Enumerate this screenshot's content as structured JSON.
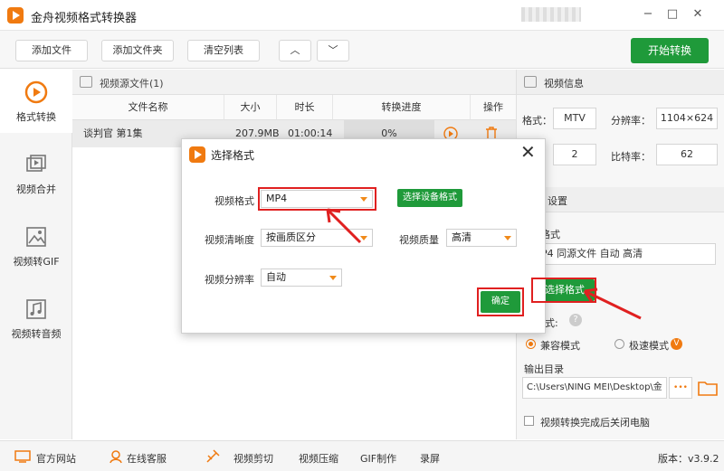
{
  "app": {
    "title": "金舟视频格式转换器",
    "minimize": "−",
    "maximize": "□",
    "close": "✕"
  },
  "toolbar": {
    "add_file": "添加文件",
    "add_folder": "添加文件夹",
    "clear_list": "清空列表",
    "up": "︿",
    "down": "﹀",
    "start": "开始转换"
  },
  "nav": [
    {
      "label": "格式转换",
      "icon": "format-convert-icon",
      "active": true
    },
    {
      "label": "视频合并",
      "icon": "video-merge-icon",
      "active": false
    },
    {
      "label": "视频转GIF",
      "icon": "video-to-gif-icon",
      "active": false
    },
    {
      "label": "视频转音频",
      "icon": "video-to-audio-icon",
      "active": false
    }
  ],
  "file_list": {
    "header": "视频源文件(1)",
    "columns": [
      "文件名称",
      "大小",
      "时长",
      "转换进度",
      "操作"
    ],
    "rows": [
      {
        "name": "谈判官 第1集",
        "size": "207.9MB",
        "duration": "01:00:14",
        "progress": "0%"
      }
    ]
  },
  "video_info": {
    "header": "视频信息",
    "format_label": "格式：",
    "format": "MTV",
    "resolution_label": "分辨率：",
    "resolution": "1104×624",
    "frame_value": "2",
    "ratio_label": "比特率：",
    "ratio": "62"
  },
  "output": {
    "header": "设置",
    "format_label": "格式",
    "format_summary": "P4 同源文件 自动 高清",
    "choose_format": "选择格式",
    "mode_label": "模式:",
    "mode_compat": "兼容模式",
    "mode_fast": "极速模式",
    "vip_badge": "V",
    "dir_label": "输出目录",
    "dir_value": "C:\\Users\\NING MEI\\Desktop\\金",
    "dots": "•••",
    "shutdown": "视频转换完成后关闭电脑"
  },
  "footer": {
    "website": "官方网站",
    "service": "在线客服",
    "clip": "视频剪切",
    "compress": "视频压缩",
    "gif": "GIF制作",
    "record": "录屏",
    "version": "版本：v3.9.2"
  },
  "modal": {
    "title": "选择格式",
    "video_format_label": "视频格式",
    "video_format": "MP4",
    "device_format_btn": "选择设备格式",
    "clarity_label": "视频清晰度",
    "clarity": "按画质区分",
    "quality_label": "视频质量",
    "quality": "高清",
    "resolution_label": "视频分辨率",
    "resolution": "自动",
    "confirm": "确定",
    "close": "✕"
  },
  "colors": {
    "brand_orange": "#f07a10",
    "action_green": "#1f9a3a",
    "highlight_red": "#e02020"
  }
}
